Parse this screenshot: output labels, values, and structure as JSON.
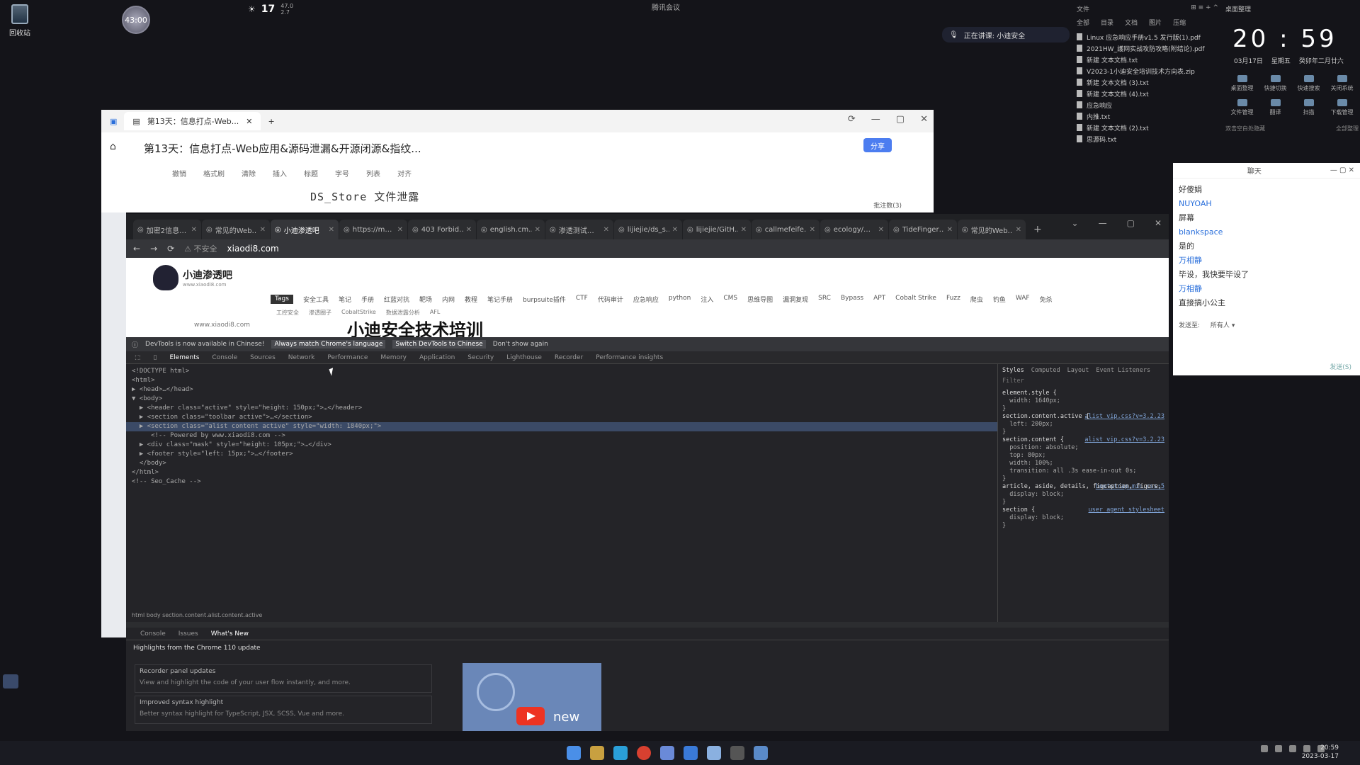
{
  "desktop": {
    "recycle_label": "回收站",
    "timer": "43:00",
    "weather_temp": "17",
    "weather_small_1": "47.0",
    "weather_small_2": "2.7",
    "meeting_top": "腾讯会议",
    "presenting": "正在讲课: 小迪安全"
  },
  "file_panel": {
    "title": "文件",
    "tabs": [
      "全部",
      "目录",
      "文档",
      "图片",
      "压缩"
    ],
    "files": [
      "Linux 应急响应手册v1.5 发行版(1).pdf",
      "2021HW_護网实战攻防攻略(附结论).pdf",
      "新建 文本文档.txt",
      "V2023-1小迪安全培训技术方向表.zip",
      "新建 文本文档 (3).txt",
      "新建 文本文档 (4).txt",
      "应急响应",
      "内推.txt",
      "新建 文本文档 (2).txt",
      "思源码.txt"
    ]
  },
  "clock_panel": {
    "title": "桌面整理",
    "time": "20 : 59",
    "date": "03月17日",
    "weekday": "星期五",
    "lunar": "癸卯年二月廿六",
    "quick": [
      "桌面整理",
      "快捷切换",
      "快速搜索",
      "关闭系统",
      "文件管理",
      "翻译",
      "扫描",
      "下载管理"
    ],
    "footer_left": "双击空白处隐藏",
    "footer_right": "全部整理"
  },
  "chat": {
    "title": "聊天",
    "messages": [
      {
        "text": "好傻娟",
        "name": false
      },
      {
        "text": "NUYOAH",
        "name": true
      },
      {
        "text": "屏幕",
        "name": false
      },
      {
        "text": "blankspace",
        "name": true
      },
      {
        "text": "是的",
        "name": false
      },
      {
        "text": "万相静",
        "name": true
      },
      {
        "text": "毕设，我快要毕设了",
        "name": false
      },
      {
        "text": "万相静",
        "name": true
      },
      {
        "text": "直接搞小公主",
        "name": false
      }
    ],
    "send_to_label": "发送至:",
    "send_to_value": "所有人",
    "send_button": "发送(S)"
  },
  "notes": {
    "tab_label": "第13天：信息打点-Web...",
    "title": "第13天：信息打点-Web应用&源码泄漏&开源闭源&指纹...",
    "toolbar": [
      "撤销",
      "格式刷",
      "清除",
      "插入",
      "标题",
      "字号",
      "列表",
      "对齐"
    ],
    "ds_store": "DS_Store 文件泄露",
    "word_count": "批注数(3)",
    "share": "分享"
  },
  "browser": {
    "tabs": [
      {
        "label": "加密2信息…",
        "active": false
      },
      {
        "label": "常见的Web…",
        "active": false
      },
      {
        "label": "小迪渗透吧",
        "active": true
      },
      {
        "label": "https://m…",
        "active": false
      },
      {
        "label": "403 Forbid…",
        "active": false
      },
      {
        "label": "english.cm…",
        "active": false
      },
      {
        "label": "渗透测试…",
        "active": false
      },
      {
        "label": "lijiejie/ds_s…",
        "active": false
      },
      {
        "label": "lijiejie/GitH…",
        "active": false
      },
      {
        "label": "callmefeife…",
        "active": false
      },
      {
        "label": "ecology/…",
        "active": false
      },
      {
        "label": "TideFinger…",
        "active": false
      },
      {
        "label": "常见的Web…",
        "active": false
      }
    ],
    "insecure": "不安全",
    "url": "xiaodi8.com"
  },
  "site": {
    "logo": "小迪渗透吧",
    "logo_sub": "www.xiaodi8.com",
    "nav": [
      "Tags",
      "安全工具",
      "笔记",
      "手册",
      "红蓝对抗",
      "靶场",
      "内网",
      "教程",
      "笔记手册",
      "burpsuite插件",
      "CTF",
      "代码审计",
      "应急响应",
      "python",
      "注入",
      "CMS",
      "思维导图",
      "漏洞复现",
      "SRC",
      "Bypass",
      "APT",
      "Cobalt Strike",
      "Fuzz",
      "爬虫",
      "钓鱼",
      "WAF",
      "免杀"
    ],
    "nav2": [
      "工控安全",
      "渗透圈子",
      "CobaltStrike",
      "数据泄露分析",
      "AFL"
    ],
    "banner": "小迪安全技术培训",
    "site_url": "www.xiaodi8.com"
  },
  "devtools": {
    "info": "DevTools is now available in Chinese!",
    "btn_match": "Always match Chrome's language",
    "btn_switch": "Switch DevTools to Chinese",
    "dont_show": "Don't show again",
    "tabs": [
      "Elements",
      "Console",
      "Sources",
      "Network",
      "Performance",
      "Memory",
      "Application",
      "Security",
      "Lighthouse",
      "Recorder",
      "Performance insights"
    ],
    "dom": [
      "<!DOCTYPE html>",
      "<html>",
      "▶ <head>…</head>",
      "▼ <body>",
      "  ▶ <header class=\"active\" style=\"height: 150px;\">…</header>",
      "  ▶ <section class=\"toolbar active\">…</section>",
      "  ▶ <section class=\"alist content active\" style=\"width: 1840px;\">",
      "     <!-- Powered by www.xiaodi8.com -->",
      "  ▶ <div class=\"mask\" style=\"height: 105px;\">…</div>",
      "  ▶ <footer style=\"left: 15px;\">…</footer>",
      "  </body>",
      "</html>",
      "<!-- Seo_Cache -->"
    ],
    "styles_tabs": [
      "Styles",
      "Computed",
      "Layout",
      "Event Listeners"
    ],
    "filter": "Filter",
    "styles": [
      {
        "sel": "element.style {",
        "src": ""
      },
      {
        "sel": "  width: 1640px;",
        "src": ""
      },
      {
        "sel": "}",
        "src": ""
      },
      {
        "sel": "section.content.active {",
        "src": "alist_vip.css?v=3.2.23"
      },
      {
        "sel": "  left: 200px;",
        "src": ""
      },
      {
        "sel": "}",
        "src": ""
      },
      {
        "sel": "section.content {",
        "src": "alist_vip.css?v=3.2.23"
      },
      {
        "sel": "  position: absolute;",
        "src": ""
      },
      {
        "sel": "  top: 80px;",
        "src": ""
      },
      {
        "sel": "  width: 100%;",
        "src": ""
      },
      {
        "sel": "  transition: all .3s ease-in-out 0s;",
        "src": ""
      },
      {
        "sel": "}",
        "src": ""
      },
      {
        "sel": "article, aside, details, figcaption, figure, footer, header, hgroup, main, menu, nav, section, summary {",
        "src": "bootstrap.min.css:5"
      },
      {
        "sel": "  display: block;",
        "src": ""
      },
      {
        "sel": "}",
        "src": ""
      },
      {
        "sel": "section {",
        "src": "user agent stylesheet"
      },
      {
        "sel": "  display: block;",
        "src": ""
      },
      {
        "sel": "}",
        "src": ""
      }
    ],
    "breadcrumb": "html  body  section.content.alist.content.active"
  },
  "drawer": {
    "tabs": [
      "Console",
      "Issues",
      "What's New"
    ],
    "heading": "Highlights from the Chrome 110 update",
    "cards": [
      {
        "title": "Recorder panel updates",
        "desc": "View and highlight the code of your user flow instantly, and more."
      },
      {
        "title": "Improved syntax highlight",
        "desc": "Better syntax highlight for TypeScript, JSX, SCSS, Vue and more."
      }
    ],
    "video_label": "new"
  },
  "taskbar": {
    "time": "20:59",
    "date": "2023-03-17"
  }
}
